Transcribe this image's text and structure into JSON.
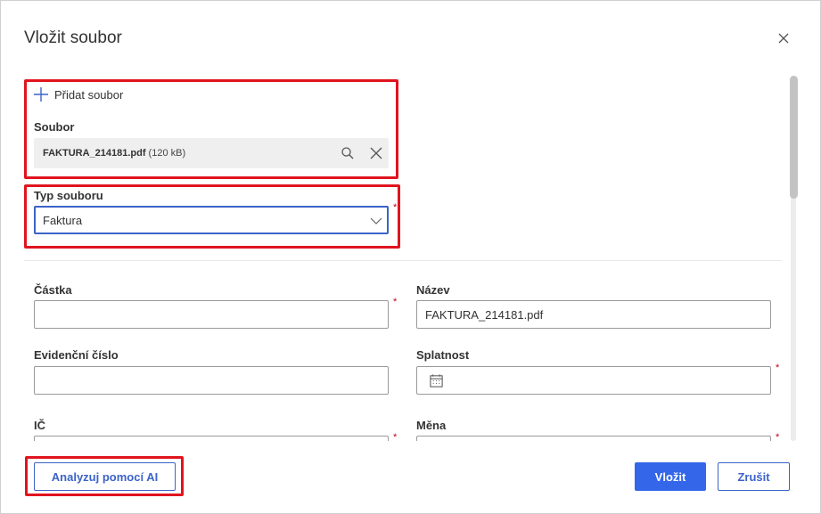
{
  "dialog": {
    "title": "Vložit soubor"
  },
  "upload": {
    "add_label": "Přidat soubor",
    "file_label": "Soubor",
    "file_name": "FAKTURA_214181.pdf",
    "file_size": "(120 kB)"
  },
  "file_type": {
    "label": "Typ souboru",
    "value": "Faktura",
    "required_mark": "*"
  },
  "fields": {
    "castka": {
      "label": "Částka",
      "value": "",
      "required_mark": "*"
    },
    "nazev": {
      "label": "Název",
      "value": "FAKTURA_214181.pdf"
    },
    "evidencni": {
      "label": "Evidenční číslo",
      "value": ""
    },
    "splatnost": {
      "label": "Splatnost",
      "value": "",
      "required_mark": "*"
    },
    "ic": {
      "label": "IČ",
      "value": "",
      "required_mark": "*"
    },
    "mena": {
      "label": "Měna",
      "value": "",
      "required_mark": "*"
    }
  },
  "footer": {
    "analyze_label": "Analyzuj pomocí AI",
    "insert_label": "Vložit",
    "cancel_label": "Zrušit"
  },
  "colors": {
    "accent": "#3366e8",
    "highlight": "#e0141e",
    "required": "#c0001a"
  },
  "icons": [
    "close-icon",
    "plus-icon",
    "search-icon",
    "remove-file-icon",
    "chevron-down-icon",
    "calendar-icon"
  ]
}
